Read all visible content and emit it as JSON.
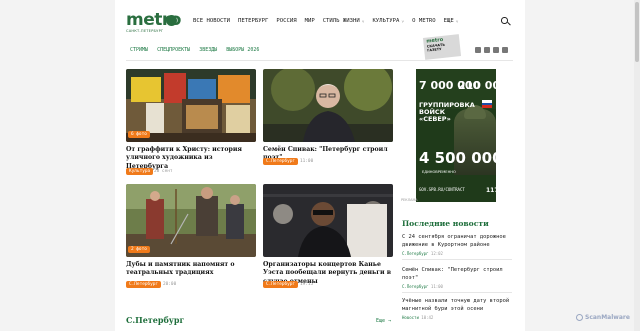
{
  "header": {
    "logo_word": "metro",
    "logo_sub": "САНКТ-ПЕТЕРБУРГ",
    "nav": [
      {
        "label": "ВСЕ НОВОСТИ"
      },
      {
        "label": "ПЕТЕРБУРГ"
      },
      {
        "label": "РОССИЯ"
      },
      {
        "label": "МИР"
      },
      {
        "label": "СТИЛЬ ЖИЗНИ",
        "chevron": "˅"
      },
      {
        "label": "КУЛЬТУРА",
        "chevron": "˅"
      },
      {
        "label": "О METRO"
      },
      {
        "label": "ЕЩЕ",
        "chevron": "˅"
      }
    ]
  },
  "subnav": [
    "СТРИМЫ",
    "СПЕЦПРОЕКТЫ",
    "ЗВЕЗДЫ",
    "ВЫБОРЫ 2026"
  ],
  "promo": {
    "logo": "metro",
    "text": "СКАЧАТЬ ГАЗЕТУ"
  },
  "cards": [
    {
      "title": "От граффити к Христу: история уличного художника из Петербурга",
      "tag": "Культура",
      "time": "20 сент",
      "badge": "6 фото"
    },
    {
      "title": "Семён Спивак: \"Петербург строил поэт\"",
      "tag": "С.Петербург",
      "time": "11:00",
      "badge": ""
    },
    {
      "title": "Дубы и памятник напомнят о театральных традициях",
      "tag": "С.Петербург",
      "time": "20:00",
      "badge": "2 фото"
    },
    {
      "title": "Организаторы концертов Канье Уэста пообещали вернуть деньги в случае отмены",
      "tag": "С.Петербург",
      "time": "19:15",
      "badge": ""
    }
  ],
  "ad": {
    "n1": "7 000 000",
    "n2": "210 000",
    "group": "ГРУППИРОВКА ВОЙСК «СЕВЕР»",
    "sum": "4 500 000",
    "once": "ЕДИНОВРЕМЕННО",
    "url": "GOV.SPB.RU/CONTRACT",
    "age": "117",
    "label": "РЕКЛАМА"
  },
  "latest": {
    "title": "Последние новости",
    "items": [
      {
        "text": "С 24 сентября ограничат дорожное движение в Курортном районе",
        "cat": "С.Петербург",
        "time": "12:02"
      },
      {
        "text": "Семён Спивак: \"Петербург строил поэт\"",
        "cat": "С.Петербург",
        "time": "11:00"
      },
      {
        "text": "Учёные назвали точную дату второй магнитной бури этой осени",
        "cat": "Новости",
        "time": "10:42"
      }
    ]
  },
  "section": {
    "title": "С.Петербург",
    "more": "Еще →"
  },
  "watermark": "ScanMalware"
}
